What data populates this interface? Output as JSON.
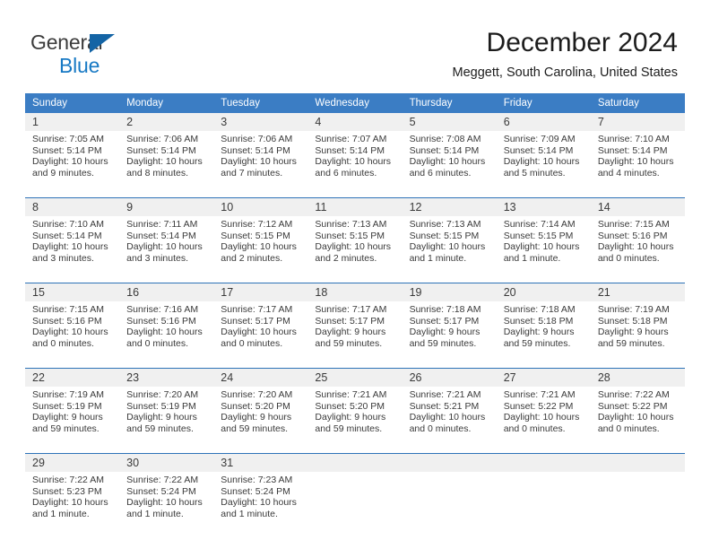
{
  "brand": {
    "name_part1": "General",
    "name_part2": "Blue",
    "logo_icon": "triangle-icon",
    "colors": {
      "dark": "#3b3b3b",
      "blue": "#1779c4",
      "triangle": "#1464a5"
    }
  },
  "header": {
    "title": "December 2024",
    "subtitle": "Meggett, South Carolina, United States"
  },
  "calendar": {
    "header_background": "#3b7dc4",
    "day_band_background": "#f0f0f0",
    "separator_color": "#2e73b8",
    "weekdays": [
      "Sunday",
      "Monday",
      "Tuesday",
      "Wednesday",
      "Thursday",
      "Friday",
      "Saturday"
    ],
    "weeks": [
      [
        {
          "day": "1",
          "sunrise": "Sunrise: 7:05 AM",
          "sunset": "Sunset: 5:14 PM",
          "daylight_1": "Daylight: 10 hours",
          "daylight_2": "and 9 minutes."
        },
        {
          "day": "2",
          "sunrise": "Sunrise: 7:06 AM",
          "sunset": "Sunset: 5:14 PM",
          "daylight_1": "Daylight: 10 hours",
          "daylight_2": "and 8 minutes."
        },
        {
          "day": "3",
          "sunrise": "Sunrise: 7:06 AM",
          "sunset": "Sunset: 5:14 PM",
          "daylight_1": "Daylight: 10 hours",
          "daylight_2": "and 7 minutes."
        },
        {
          "day": "4",
          "sunrise": "Sunrise: 7:07 AM",
          "sunset": "Sunset: 5:14 PM",
          "daylight_1": "Daylight: 10 hours",
          "daylight_2": "and 6 minutes."
        },
        {
          "day": "5",
          "sunrise": "Sunrise: 7:08 AM",
          "sunset": "Sunset: 5:14 PM",
          "daylight_1": "Daylight: 10 hours",
          "daylight_2": "and 6 minutes."
        },
        {
          "day": "6",
          "sunrise": "Sunrise: 7:09 AM",
          "sunset": "Sunset: 5:14 PM",
          "daylight_1": "Daylight: 10 hours",
          "daylight_2": "and 5 minutes."
        },
        {
          "day": "7",
          "sunrise": "Sunrise: 7:10 AM",
          "sunset": "Sunset: 5:14 PM",
          "daylight_1": "Daylight: 10 hours",
          "daylight_2": "and 4 minutes."
        }
      ],
      [
        {
          "day": "8",
          "sunrise": "Sunrise: 7:10 AM",
          "sunset": "Sunset: 5:14 PM",
          "daylight_1": "Daylight: 10 hours",
          "daylight_2": "and 3 minutes."
        },
        {
          "day": "9",
          "sunrise": "Sunrise: 7:11 AM",
          "sunset": "Sunset: 5:14 PM",
          "daylight_1": "Daylight: 10 hours",
          "daylight_2": "and 3 minutes."
        },
        {
          "day": "10",
          "sunrise": "Sunrise: 7:12 AM",
          "sunset": "Sunset: 5:15 PM",
          "daylight_1": "Daylight: 10 hours",
          "daylight_2": "and 2 minutes."
        },
        {
          "day": "11",
          "sunrise": "Sunrise: 7:13 AM",
          "sunset": "Sunset: 5:15 PM",
          "daylight_1": "Daylight: 10 hours",
          "daylight_2": "and 2 minutes."
        },
        {
          "day": "12",
          "sunrise": "Sunrise: 7:13 AM",
          "sunset": "Sunset: 5:15 PM",
          "daylight_1": "Daylight: 10 hours",
          "daylight_2": "and 1 minute."
        },
        {
          "day": "13",
          "sunrise": "Sunrise: 7:14 AM",
          "sunset": "Sunset: 5:15 PM",
          "daylight_1": "Daylight: 10 hours",
          "daylight_2": "and 1 minute."
        },
        {
          "day": "14",
          "sunrise": "Sunrise: 7:15 AM",
          "sunset": "Sunset: 5:16 PM",
          "daylight_1": "Daylight: 10 hours",
          "daylight_2": "and 0 minutes."
        }
      ],
      [
        {
          "day": "15",
          "sunrise": "Sunrise: 7:15 AM",
          "sunset": "Sunset: 5:16 PM",
          "daylight_1": "Daylight: 10 hours",
          "daylight_2": "and 0 minutes."
        },
        {
          "day": "16",
          "sunrise": "Sunrise: 7:16 AM",
          "sunset": "Sunset: 5:16 PM",
          "daylight_1": "Daylight: 10 hours",
          "daylight_2": "and 0 minutes."
        },
        {
          "day": "17",
          "sunrise": "Sunrise: 7:17 AM",
          "sunset": "Sunset: 5:17 PM",
          "daylight_1": "Daylight: 10 hours",
          "daylight_2": "and 0 minutes."
        },
        {
          "day": "18",
          "sunrise": "Sunrise: 7:17 AM",
          "sunset": "Sunset: 5:17 PM",
          "daylight_1": "Daylight: 9 hours",
          "daylight_2": "and 59 minutes."
        },
        {
          "day": "19",
          "sunrise": "Sunrise: 7:18 AM",
          "sunset": "Sunset: 5:17 PM",
          "daylight_1": "Daylight: 9 hours",
          "daylight_2": "and 59 minutes."
        },
        {
          "day": "20",
          "sunrise": "Sunrise: 7:18 AM",
          "sunset": "Sunset: 5:18 PM",
          "daylight_1": "Daylight: 9 hours",
          "daylight_2": "and 59 minutes."
        },
        {
          "day": "21",
          "sunrise": "Sunrise: 7:19 AM",
          "sunset": "Sunset: 5:18 PM",
          "daylight_1": "Daylight: 9 hours",
          "daylight_2": "and 59 minutes."
        }
      ],
      [
        {
          "day": "22",
          "sunrise": "Sunrise: 7:19 AM",
          "sunset": "Sunset: 5:19 PM",
          "daylight_1": "Daylight: 9 hours",
          "daylight_2": "and 59 minutes."
        },
        {
          "day": "23",
          "sunrise": "Sunrise: 7:20 AM",
          "sunset": "Sunset: 5:19 PM",
          "daylight_1": "Daylight: 9 hours",
          "daylight_2": "and 59 minutes."
        },
        {
          "day": "24",
          "sunrise": "Sunrise: 7:20 AM",
          "sunset": "Sunset: 5:20 PM",
          "daylight_1": "Daylight: 9 hours",
          "daylight_2": "and 59 minutes."
        },
        {
          "day": "25",
          "sunrise": "Sunrise: 7:21 AM",
          "sunset": "Sunset: 5:20 PM",
          "daylight_1": "Daylight: 9 hours",
          "daylight_2": "and 59 minutes."
        },
        {
          "day": "26",
          "sunrise": "Sunrise: 7:21 AM",
          "sunset": "Sunset: 5:21 PM",
          "daylight_1": "Daylight: 10 hours",
          "daylight_2": "and 0 minutes."
        },
        {
          "day": "27",
          "sunrise": "Sunrise: 7:21 AM",
          "sunset": "Sunset: 5:22 PM",
          "daylight_1": "Daylight: 10 hours",
          "daylight_2": "and 0 minutes."
        },
        {
          "day": "28",
          "sunrise": "Sunrise: 7:22 AM",
          "sunset": "Sunset: 5:22 PM",
          "daylight_1": "Daylight: 10 hours",
          "daylight_2": "and 0 minutes."
        }
      ],
      [
        {
          "day": "29",
          "sunrise": "Sunrise: 7:22 AM",
          "sunset": "Sunset: 5:23 PM",
          "daylight_1": "Daylight: 10 hours",
          "daylight_2": "and 1 minute."
        },
        {
          "day": "30",
          "sunrise": "Sunrise: 7:22 AM",
          "sunset": "Sunset: 5:24 PM",
          "daylight_1": "Daylight: 10 hours",
          "daylight_2": "and 1 minute."
        },
        {
          "day": "31",
          "sunrise": "Sunrise: 7:23 AM",
          "sunset": "Sunset: 5:24 PM",
          "daylight_1": "Daylight: 10 hours",
          "daylight_2": "and 1 minute."
        },
        {
          "day": "",
          "sunrise": "",
          "sunset": "",
          "daylight_1": "",
          "daylight_2": ""
        },
        {
          "day": "",
          "sunrise": "",
          "sunset": "",
          "daylight_1": "",
          "daylight_2": ""
        },
        {
          "day": "",
          "sunrise": "",
          "sunset": "",
          "daylight_1": "",
          "daylight_2": ""
        },
        {
          "day": "",
          "sunrise": "",
          "sunset": "",
          "daylight_1": "",
          "daylight_2": ""
        }
      ]
    ]
  }
}
